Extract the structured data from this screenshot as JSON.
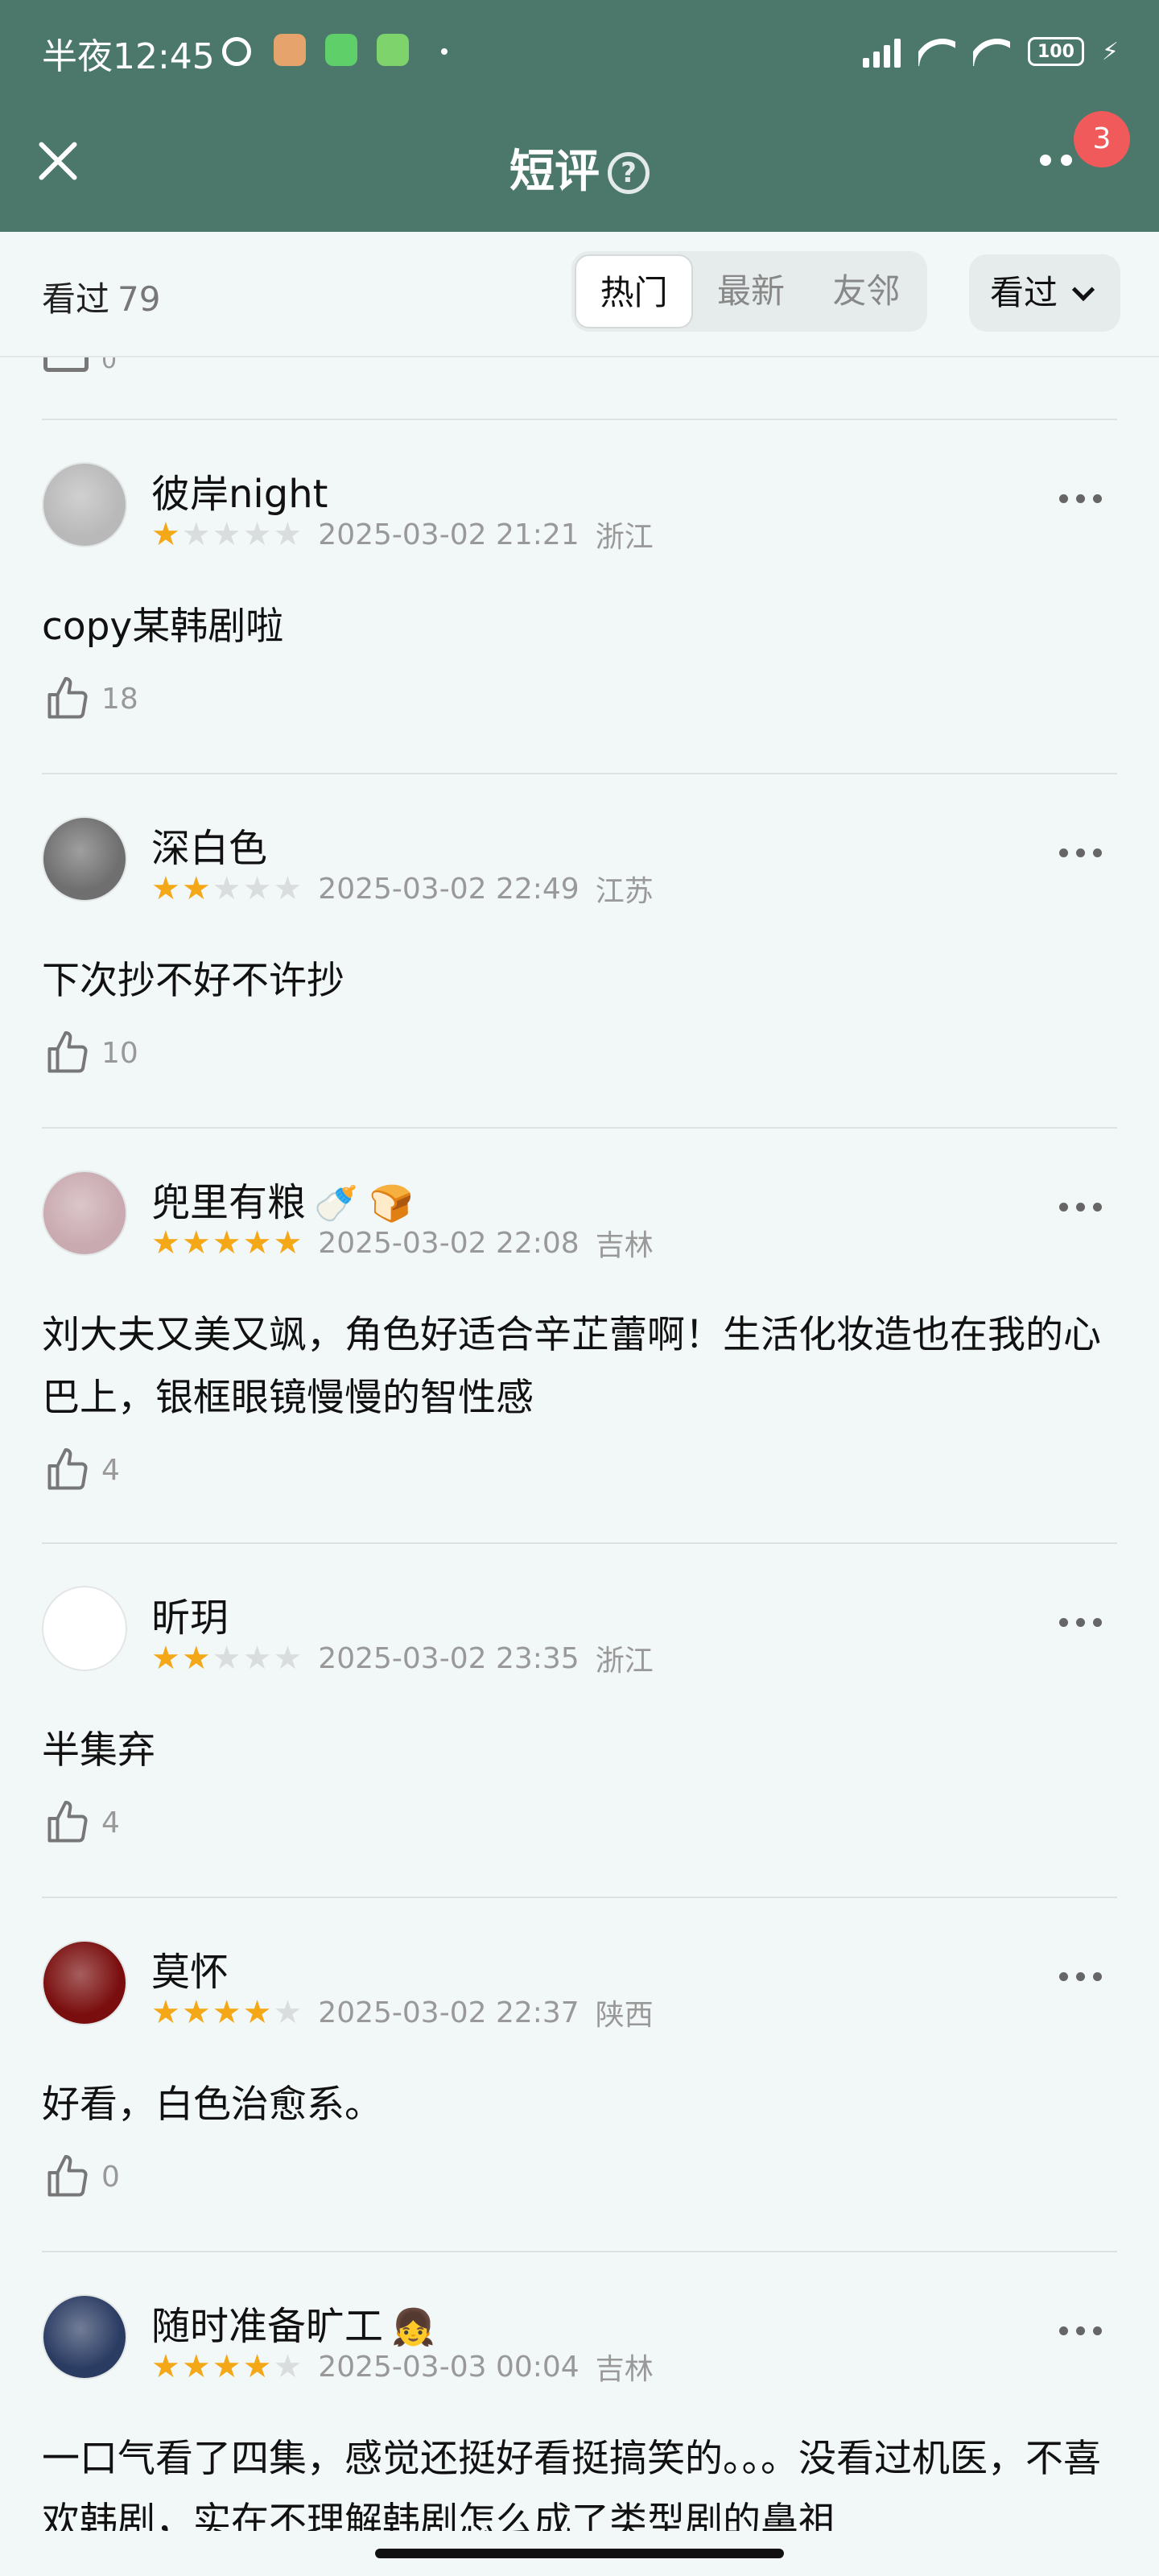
{
  "status": {
    "time": "半夜12:45",
    "battery": "100"
  },
  "header": {
    "title": "短评",
    "help": "?",
    "badge": "3"
  },
  "subbar": {
    "seen_label": "看过",
    "seen_count": "79",
    "tabs": [
      "热门",
      "最新",
      "友邻"
    ],
    "filter_label": "看过"
  },
  "partial_like": "0",
  "reviews": [
    {
      "name": "彼岸night",
      "emoji": "",
      "stars": 1,
      "date": "2025-03-02 21:21",
      "location": "浙江",
      "content": "copy某韩剧啦",
      "likes": "18",
      "avatar_color": "#b9b9b9"
    },
    {
      "name": "深白色",
      "emoji": "",
      "stars": 2,
      "date": "2025-03-02 22:49",
      "location": "江苏",
      "content": "下次抄不好不许抄",
      "likes": "10",
      "avatar_color": "#6f6f6f"
    },
    {
      "name": "兜里有粮",
      "emoji": "🍼 🍞",
      "stars": 5,
      "date": "2025-03-02 22:08",
      "location": "吉林",
      "content": "刘大夫又美又飒，角色好适合辛芷蕾啊！生活化妆造也在我的心巴上，银框眼镜慢慢的智性感",
      "likes": "4",
      "avatar_color": "#c9aab0"
    },
    {
      "name": "昕玥",
      "emoji": "",
      "stars": 2,
      "date": "2025-03-02 23:35",
      "location": "浙江",
      "content": "半集弃",
      "likes": "4",
      "avatar_color": "#ffffff"
    },
    {
      "name": "莫怀",
      "emoji": "",
      "stars": 4,
      "date": "2025-03-02 22:37",
      "location": "陕西",
      "content": "好看，白色治愈系。",
      "likes": "0",
      "avatar_color": "#7a0e0e"
    },
    {
      "name": "随时准备旷工",
      "emoji": "👧",
      "stars": 4,
      "date": "2025-03-03 00:04",
      "location": "吉林",
      "content": "一口气看了四集，感觉还挺好看挺搞笑的。。。没看过机医，不喜欢韩剧，实在不理解韩剧怎么成了类型剧的鼻祖",
      "likes": "",
      "avatar_color": "#2b3c63"
    }
  ]
}
